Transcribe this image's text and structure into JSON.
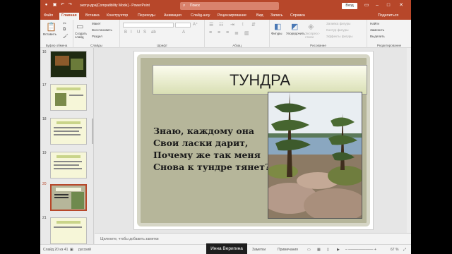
{
  "window": {
    "title": "экотундра[Compatibility Mode]  -  PowerPoint",
    "search_placeholder": "Поиск",
    "signin_label": "Вход"
  },
  "menu": {
    "tabs": [
      "Файл",
      "Главная",
      "Вставка",
      "Конструктор",
      "Переходы",
      "Анимация",
      "Слайд-шоу",
      "Рецензирование",
      "Вид",
      "Запись",
      "Справка"
    ],
    "active_index": 1,
    "share_label": "Поделиться"
  },
  "ribbon": {
    "clipboard": {
      "paste_label": "Вставить",
      "group": "Буфер обмена"
    },
    "slides": {
      "new_slide_label": "Создать слайд",
      "layout_label": "Макет",
      "reset_label": "Восстановить",
      "section_label": "Раздел",
      "group": "Слайды"
    },
    "font": {
      "group": "Шрифт"
    },
    "paragraph": {
      "group": "Абзац"
    },
    "drawing": {
      "shapes_label": "Фигуры",
      "arrange_label": "Упорядочить",
      "quick_styles_label": "Экспресс-стили",
      "fill_label": "Заливка фигуры",
      "outline_label": "Контур фигуры",
      "effects_label": "Эффекты фигуры",
      "group": "Рисование"
    },
    "editing": {
      "find_label": "Найти",
      "replace_label": "Заменить",
      "select_label": "Выделить",
      "group": "Редактирование"
    }
  },
  "thumbnails": [
    {
      "number": "16"
    },
    {
      "number": "17"
    },
    {
      "number": "18"
    },
    {
      "number": "19"
    },
    {
      "number": "20",
      "selected": true
    },
    {
      "number": "21"
    }
  ],
  "slide": {
    "title": "ТУНДРА",
    "poem_lines": [
      "Знаю, каждому она",
      "Свои ласки дарит,",
      "Почему же так меня",
      "Снова к тундре тянет?"
    ]
  },
  "notes_placeholder": "Щелкните, чтобы добавить заметки",
  "status": {
    "slide_counter": "Слайд 20 из 41",
    "language": "русский",
    "notes_label": "Заметки",
    "comments_label": "Примечания",
    "zoom": "67 %"
  },
  "user_tag": "Инна Веригина",
  "colors": {
    "accent": "#b7472a",
    "slide_panel": "#b6b69a"
  }
}
